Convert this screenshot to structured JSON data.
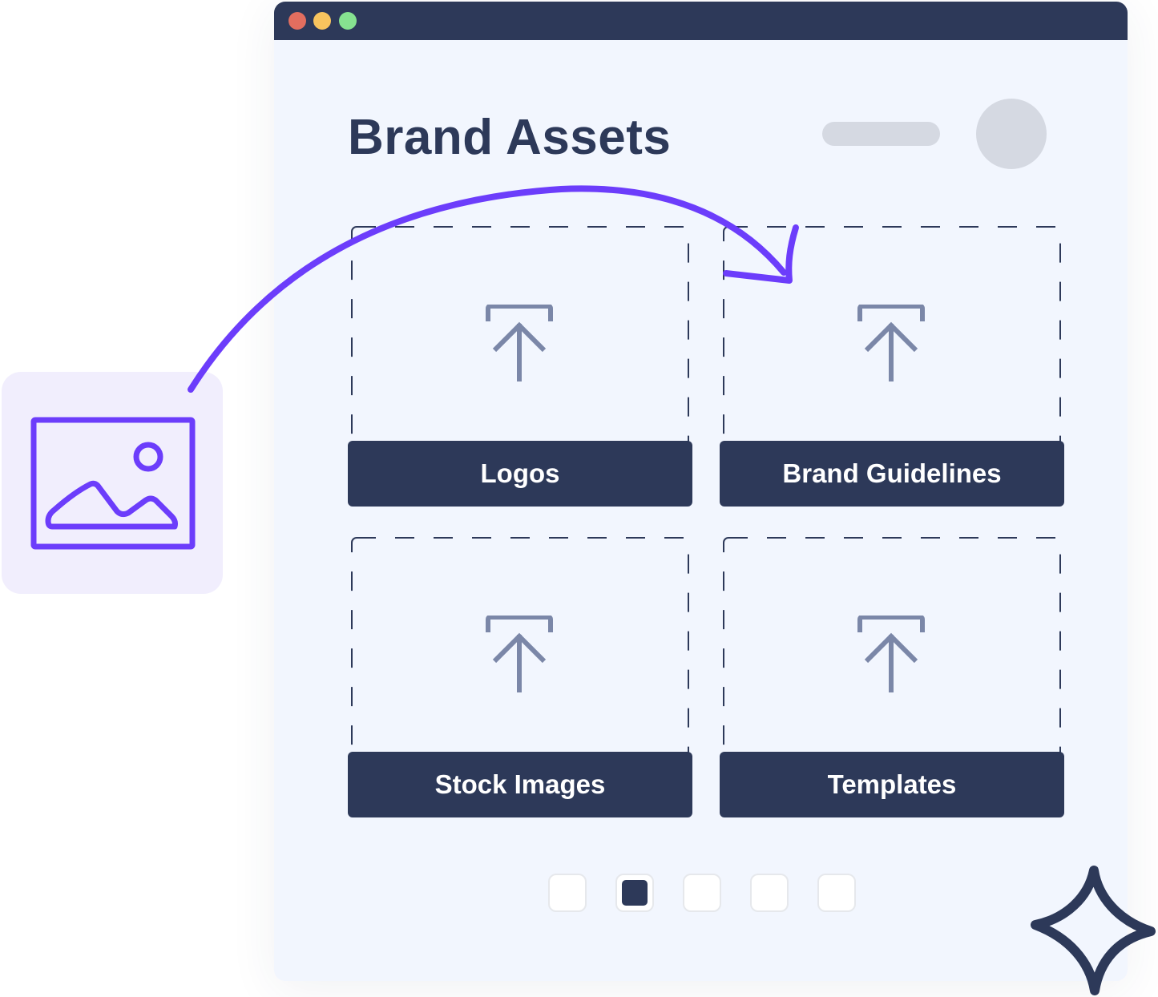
{
  "window": {
    "traffic_lights": [
      "close",
      "minimize",
      "maximize"
    ],
    "colors": {
      "titlebar": "#2d3959",
      "close": "#e26e5f",
      "minimize": "#f8c45e",
      "maximize": "#86e290",
      "background": "#f2f6fe"
    }
  },
  "header": {
    "title": "Brand Assets"
  },
  "tiles": [
    {
      "label": "Logos",
      "icon": "upload-icon"
    },
    {
      "label": "Brand Guidelines",
      "icon": "upload-icon"
    },
    {
      "label": "Stock Images",
      "icon": "upload-icon"
    },
    {
      "label": "Templates",
      "icon": "upload-icon"
    }
  ],
  "pagination": {
    "pages": 5,
    "active_index": 1
  },
  "decor": {
    "dragged_item_icon": "image-icon",
    "drag_arrow_color": "#6c3dfb",
    "sparkle_icon": "sparkle-icon",
    "accent": "#6c3dfb",
    "upload_icon_color": "#7b87a8"
  }
}
